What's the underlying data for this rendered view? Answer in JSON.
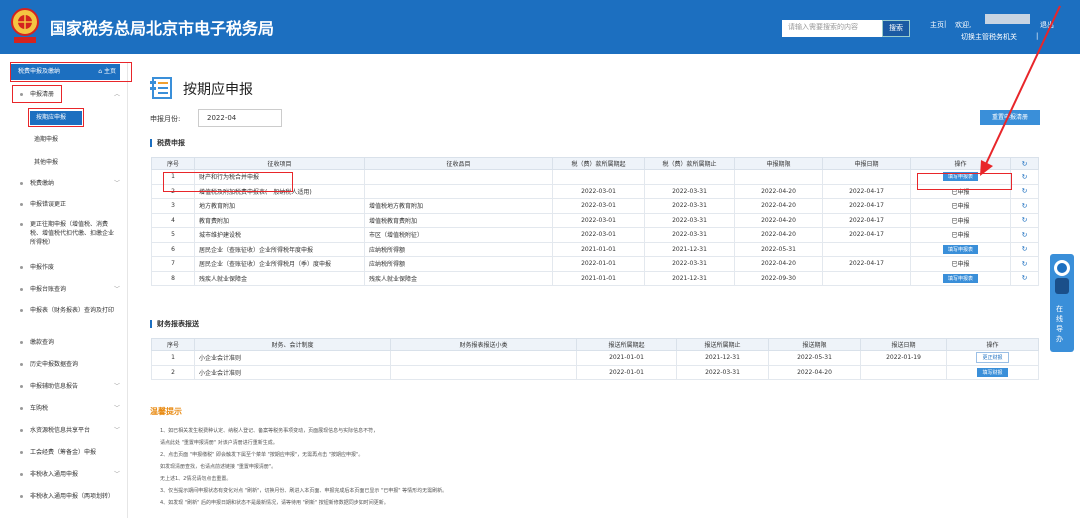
{
  "header": {
    "title": "国家税务总局北京市电子税务局",
    "search_placeholder": "请输入需要搜索的内容",
    "search_label": "搜索",
    "home": "主页",
    "welcome": "欢迎,",
    "switch_org": "切换主管税务机关",
    "logout": "退出"
  },
  "sidebar": {
    "top_label": "税费申报及缴纳",
    "home_label": "主页",
    "items": [
      {
        "label": "申报清册",
        "expanded": true
      },
      {
        "label": "税费缴纳"
      },
      {
        "label": "申报错误更正"
      },
      {
        "label": "更正往期申报（增值税、消费税、增值税代扣代缴、扣缴企业所得税）"
      },
      {
        "label": "申报作废"
      },
      {
        "label": "申报台账查询"
      },
      {
        "label": "申报表（财务报表）查询及打印"
      },
      {
        "label": "缴款查询"
      },
      {
        "label": "历史申报数据查询"
      },
      {
        "label": "申报辅助信息报告"
      },
      {
        "label": "车购税"
      },
      {
        "label": "水资源税信息共享平台"
      },
      {
        "label": "工会经费（筹备金）申报"
      },
      {
        "label": "非税收入通用申报"
      },
      {
        "label": "非税收入通用申报（两项划转）"
      }
    ],
    "sub_items": [
      "按期应申报",
      "逾期申报",
      "其他申报"
    ]
  },
  "main": {
    "title": "按期应申报",
    "period_label": "申报月份:",
    "period_value": "2022-04",
    "reset_button": "重置申报清册",
    "tax_section": "税费申报",
    "tax_headers": [
      "序号",
      "征收项目",
      "征收品目",
      "税（费）款所属期起",
      "税（费）款所属期止",
      "申报期限",
      "申报日期",
      "操作"
    ],
    "tax_rows": [
      {
        "no": "1",
        "item": "财产和行为税合并申报",
        "sub": "",
        "start": "",
        "end": "",
        "deadline": "",
        "date": "",
        "op": "填写申报表",
        "op_type": "button"
      },
      {
        "no": "2",
        "item": "增值税及附加税费申报表(一般纳税人适用)",
        "sub": "",
        "start": "2022-03-01",
        "end": "2022-03-31",
        "deadline": "2022-04-20",
        "date": "2022-04-17",
        "op": "已申报",
        "op_type": "text"
      },
      {
        "no": "3",
        "item": "地方教育附加",
        "sub": "增值税地方教育附加",
        "start": "2022-03-01",
        "end": "2022-03-31",
        "deadline": "2022-04-20",
        "date": "2022-04-17",
        "op": "已申报",
        "op_type": "text"
      },
      {
        "no": "4",
        "item": "教育费附加",
        "sub": "增值税教育费附加",
        "start": "2022-03-01",
        "end": "2022-03-31",
        "deadline": "2022-04-20",
        "date": "2022-04-17",
        "op": "已申报",
        "op_type": "text"
      },
      {
        "no": "5",
        "item": "城市维护建设税",
        "sub": "市区（增值税附征）",
        "start": "2022-03-01",
        "end": "2022-03-31",
        "deadline": "2022-04-20",
        "date": "2022-04-17",
        "op": "已申报",
        "op_type": "text"
      },
      {
        "no": "6",
        "item": "居民企业（查账征收）企业所得税年度申报",
        "sub": "应纳税所得额",
        "start": "2021-01-01",
        "end": "2021-12-31",
        "deadline": "2022-05-31",
        "date": "",
        "op": "填写申报表",
        "op_type": "button"
      },
      {
        "no": "7",
        "item": "居民企业（查账征收）企业所得税月（季）度申报",
        "sub": "应纳税所得额",
        "start": "2022-01-01",
        "end": "2022-03-31",
        "deadline": "2022-04-20",
        "date": "2022-04-17",
        "op": "已申报",
        "op_type": "text"
      },
      {
        "no": "8",
        "item": "残疾人就业保障金",
        "sub": "残疾人就业保障金",
        "start": "2021-01-01",
        "end": "2021-12-31",
        "deadline": "2022-09-30",
        "date": "",
        "op": "填写申报表",
        "op_type": "button"
      }
    ],
    "fin_section": "财务报表报送",
    "fin_headers": [
      "序号",
      "财务、会计制度",
      "财务报表报送小类",
      "报送所属期起",
      "报送所属期止",
      "报送期限",
      "报送日期",
      "操作"
    ],
    "fin_rows": [
      {
        "no": "1",
        "system": "小企业会计准则",
        "sub": "",
        "start": "2021-01-01",
        "end": "2021-12-31",
        "deadline": "2022-05-31",
        "date": "2022-01-19",
        "op": "更正财报",
        "op_type": "outline"
      },
      {
        "no": "2",
        "system": "小企业会计准则",
        "sub": "",
        "start": "2022-01-01",
        "end": "2022-03-31",
        "deadline": "2022-04-20",
        "date": "",
        "op": "填写财报",
        "op_type": "button"
      }
    ],
    "tips_title": "温馨提示",
    "tips": [
      "1、如已相关发生税费种认定、纳税人登记、备案等税务事项变动，页面展现信息与实际信息不符，",
      "请点此处 \"重置申报清册\" 对该户清册进行重新生成。",
      "2、点击页面 \"申报缴税\" 即会触发下属至个菜单 \"按期应申报\"，无需再点击 \"按期应申报\"。",
      "如发现清册查找，也请点前述链接 \"重置申报清册\"。",
      "无上述1、2情况请勿点击重置。",
      "3、仅当提示期间申报状态有变化对点 \"刷新\"，切换月份、刷进入本页面、申报完成后本页面已显示 \"已申报\" 等情形均无需刷新。",
      "4、如发现 \"刷新\" 后的申报日期和状态不是最新情况，请等待用 \"刷新\" 按钮新修数据同步如时间更新。"
    ]
  },
  "float_panel": {
    "label": "在线导办"
  },
  "colors": {
    "brand": "#1c6fc0",
    "highlight": "#e8262a",
    "button": "#3a8fd9"
  }
}
